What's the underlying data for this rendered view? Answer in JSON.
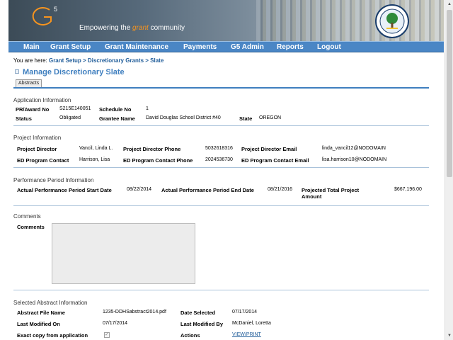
{
  "header": {
    "logo_text": "G5",
    "tagline_pre": "Empowering the ",
    "tagline_highlight": "grant",
    "tagline_post": " community",
    "seal_label": "Department of Education"
  },
  "nav": {
    "items": [
      "Main",
      "Grant Setup",
      "Grant Maintenance",
      "Payments",
      "G5 Admin",
      "Reports",
      "Logout"
    ]
  },
  "breadcrumb": {
    "prefix": "You are here: ",
    "links": [
      "Grant Setup",
      "Discretionary Grants",
      "Slate"
    ],
    "separator": " > "
  },
  "page": {
    "title": "Manage Discretionary Slate",
    "tab": "Abstracts"
  },
  "application": {
    "section_title": "Application Information",
    "pr_award_label": "PR/Award No",
    "pr_award_value": "S215E140051",
    "schedule_label": "Schedule No",
    "schedule_value": "1",
    "status_label": "Status",
    "status_value": "Obligated",
    "grantee_label": "Grantee Name",
    "grantee_value": "David Douglas School District #40",
    "state_label": "State",
    "state_value": "OREGON"
  },
  "project": {
    "section_title": "Project Information",
    "director_label": "Project Director",
    "director_value": "Vancil, Linda L.",
    "director_phone_label": "Project Director Phone",
    "director_phone_value": "5032618316",
    "director_email_label": "Project Director Email",
    "director_email_value": "linda_vancil12@NODOMAIN",
    "ed_contact_label": "ED Program Contact",
    "ed_contact_value": "Harrison, Lisa",
    "ed_phone_label": "ED Program Contact Phone",
    "ed_phone_value": "2024536730",
    "ed_email_label": "ED Program Contact Email",
    "ed_email_value": "lisa.harrison10@NODOMAIN"
  },
  "performance": {
    "section_title": "Performance Period Information",
    "start_label": "Actual Performance Period Start Date",
    "start_value": "08/22/2014",
    "end_label": "Actual Performance Period End Date",
    "end_value": "08/21/2016",
    "amount_label": "Projected Total Project Amount",
    "amount_value": "$667,196.00"
  },
  "comments": {
    "section_title": "Comments",
    "label": "Comments",
    "value": ""
  },
  "abstract": {
    "section_title": "Selected Abstract Information",
    "file_label": "Abstract File Name",
    "file_value": "1235-DDHSabstract2014.pdf",
    "date_selected_label": "Date Selected",
    "date_selected_value": "07/17/2014",
    "modified_on_label": "Last Modified On",
    "modified_on_value": "07/17/2014",
    "modified_by_label": "Last Modified By",
    "modified_by_value": "McDaniel, Loretta",
    "exact_copy_label": "Exact copy from application",
    "exact_copy_checked": true,
    "actions_label": "Actions",
    "view_print_label": "VIEW/PRINT"
  },
  "colors": {
    "nav_bg": "#4a86c5",
    "title_blue": "#3f7fbf",
    "link_blue": "#1f5c99",
    "accent_orange": "#f7941e"
  }
}
